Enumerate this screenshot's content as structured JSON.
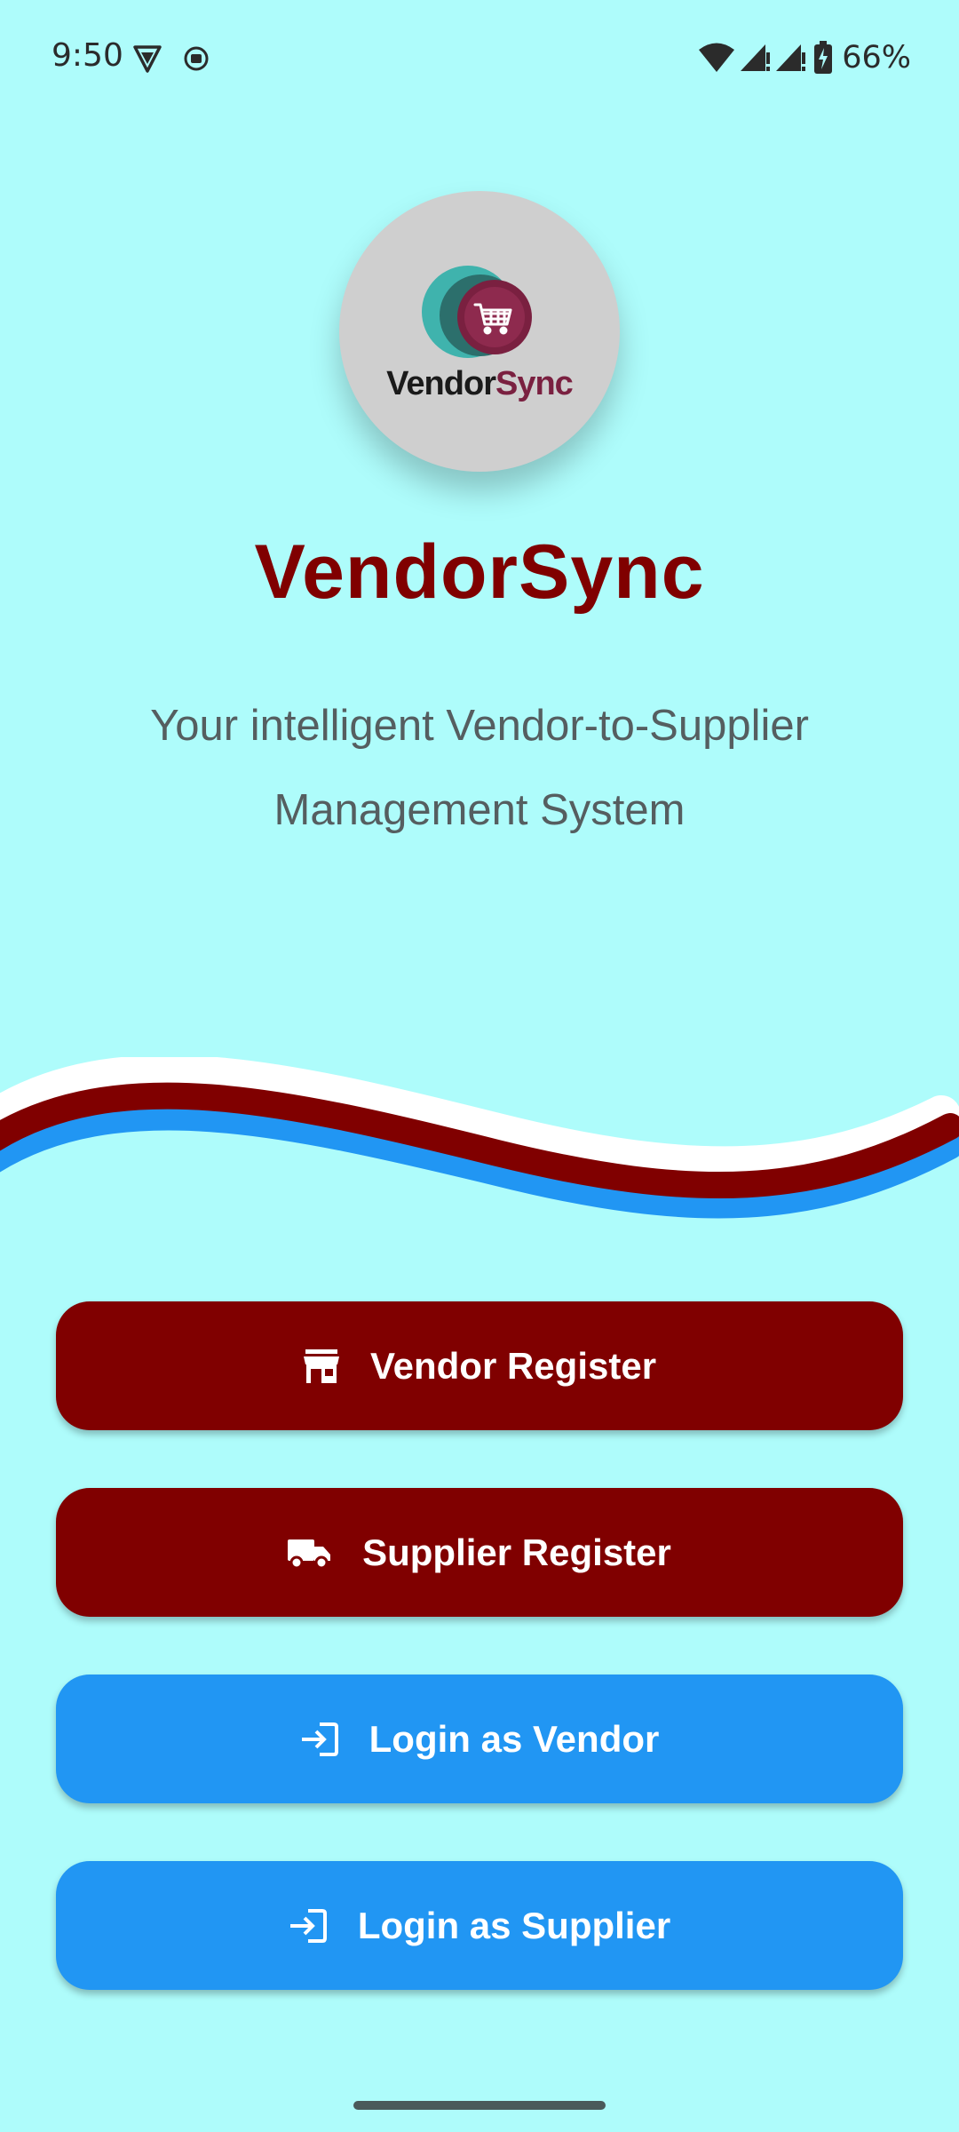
{
  "status_bar": {
    "time": "9:50",
    "battery_percent": "66%",
    "icons": [
      "vpn-shield-icon",
      "screen-record-icon",
      "wifi-icon",
      "signal-icon",
      "signal-icon",
      "battery-charging-icon"
    ]
  },
  "logo": {
    "word_part1": "Vendor",
    "word_part2": "Sync",
    "icon": "shopping-cart-icon"
  },
  "title": "VendorSync",
  "subtitle_line1": "Your intelligent Vendor-to-Supplier",
  "subtitle_line2": "Management System",
  "buttons": {
    "vendor_register": {
      "label": "Vendor Register",
      "icon": "store-icon"
    },
    "supplier_register": {
      "label": "Supplier Register",
      "icon": "truck-icon"
    },
    "login_vendor": {
      "label": "Login as Vendor",
      "icon": "login-icon"
    },
    "login_supplier": {
      "label": "Login as Supplier",
      "icon": "login-icon"
    }
  },
  "colors": {
    "background": "#aefcfb",
    "primary_dark": "#800000",
    "primary_blue": "#2196f3",
    "subtitle_text": "#555e60"
  }
}
